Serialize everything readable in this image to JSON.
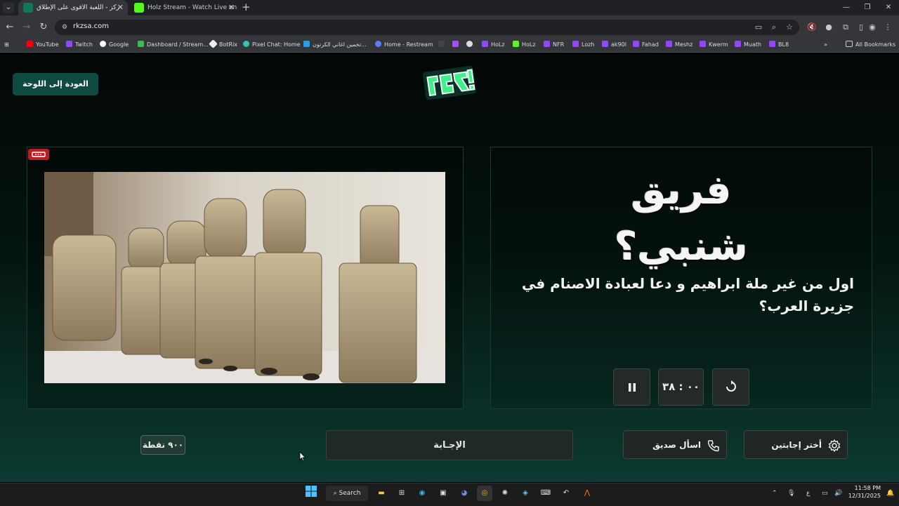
{
  "browser": {
    "tabs": [
      {
        "title": "ركز - اللعبة الاقوى على الإطلاق",
        "active": true
      },
      {
        "title": "Holz Stream - Watch Live on Ki",
        "active": false
      }
    ],
    "url": "rkzsa.com",
    "bookmarks": [
      "YouTube",
      "Twitch",
      "Google",
      "Dashboard / Stream...",
      "BotRix",
      "Pixel Chat: Home",
      "تخمين اغاني الكرتون...",
      "Home - Restream",
      "",
      "",
      "",
      "HoLz",
      "HoLz",
      "NFR",
      "Lozh",
      "ak90l",
      "Fahad",
      "Meshz",
      "Kwerm",
      "Muath",
      "BL8"
    ],
    "all_bookmarks": "All Bookmarks"
  },
  "page": {
    "back_button": "العودة إلى اللوحة",
    "logo_text": "ركز!",
    "team_name": "فريق شنبي؟",
    "question": "اول من غير ملة ابراهيم و دعا لعبادة الاصنام في جزيرة العرب؟",
    "timer": "٠٠ : ٣٨",
    "points": "٩٠٠ نقطة",
    "answer_button": "الإجـابة",
    "lifelines": {
      "ask_friend": "اسأل صديق",
      "choose_two": "أختر إجابتين"
    }
  },
  "taskbar": {
    "search": "Search",
    "time": "11:58 PM",
    "date": "12/31/2025",
    "lang": "ع"
  },
  "colors": {
    "accent": "#0e4a40",
    "badge": "#b81e22",
    "logo_green": "#3ff08a"
  }
}
